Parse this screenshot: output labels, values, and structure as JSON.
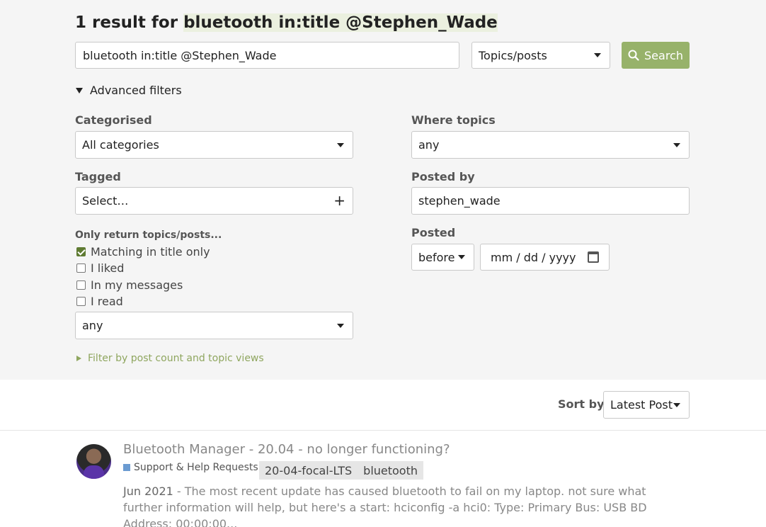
{
  "search": {
    "heading_prefix": "1 result for ",
    "heading_query": "bluetooth in:title @Stephen_Wade",
    "query_value": "bluetooth in:title @Stephen_Wade",
    "type_selected": "Topics/posts",
    "button_label": "Search"
  },
  "advanced": {
    "toggle_label": "Advanced filters",
    "categorised_label": "Categorised",
    "categorised_value": "All categories",
    "tagged_label": "Tagged",
    "tagged_placeholder": "Select…",
    "only_return_label": "Only return topics/posts...",
    "checks": [
      {
        "label": "Matching in title only",
        "checked": true
      },
      {
        "label": "I liked",
        "checked": false
      },
      {
        "label": "In my messages",
        "checked": false
      },
      {
        "label": "I read",
        "checked": false
      }
    ],
    "read_select_value": "any",
    "where_topics_label": "Where topics",
    "where_topics_value": "any",
    "posted_by_label": "Posted by",
    "posted_by_value": "stephen_wade",
    "posted_label": "Posted",
    "posted_relation": "before",
    "posted_date_placeholder": "mm / dd / yyyy",
    "filter_link": "Filter by post count and topic views"
  },
  "sort": {
    "label": "Sort by",
    "value": "Latest Post"
  },
  "results": [
    {
      "title": "Bluetooth Manager - 20.04 - no longer functioning?",
      "category": "Support & Help Requests",
      "tags": [
        "20-04-focal-LTS",
        "bluetooth"
      ],
      "date": "Jun 2021",
      "blurb": " - The most recent update has caused bluetooth to fail on my laptop. not sure what further information will help, but here's a start: hciconfig -a hci0: Type: Primary Bus: USB BD Address: 00:00:00..."
    }
  ],
  "colors": {
    "accent_green": "#97b26a",
    "highlight": "#ebf0df",
    "category_blue": "#6b9bd1"
  }
}
